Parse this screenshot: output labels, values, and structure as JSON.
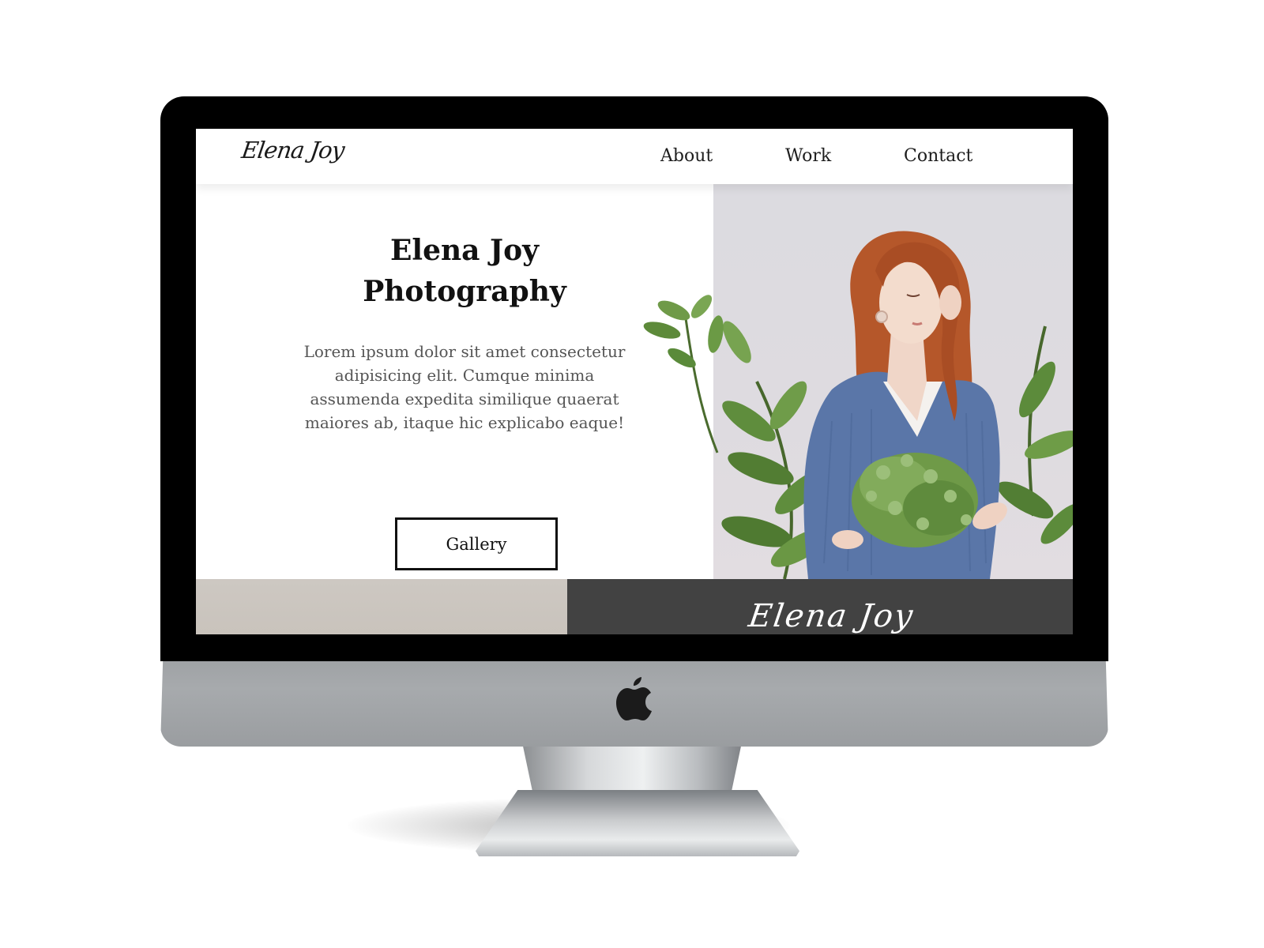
{
  "site": {
    "logo_text": "Elena Joy",
    "nav": [
      {
        "label": "About"
      },
      {
        "label": "Work"
      },
      {
        "label": "Contact"
      }
    ]
  },
  "hero": {
    "title_line1": "Elena Joy",
    "title_line2": "Photography",
    "description": "Lorem ipsum dolor sit amet consectetur adipisicing elit. Cumque minima assumenda expedita similique quaerat maiores ab, itaque hic explicabo eaque!",
    "cta_label": "Gallery"
  },
  "footer": {
    "logo_text": "Elena  Joy"
  },
  "device": {
    "brand_icon": "apple-logo-icon"
  },
  "colors": {
    "footer_bg": "#424242",
    "photo_bg": "#dcdbe0",
    "sweater": "#5a76a8",
    "hair": "#b5572a",
    "leaf": "#5a8a3a"
  }
}
